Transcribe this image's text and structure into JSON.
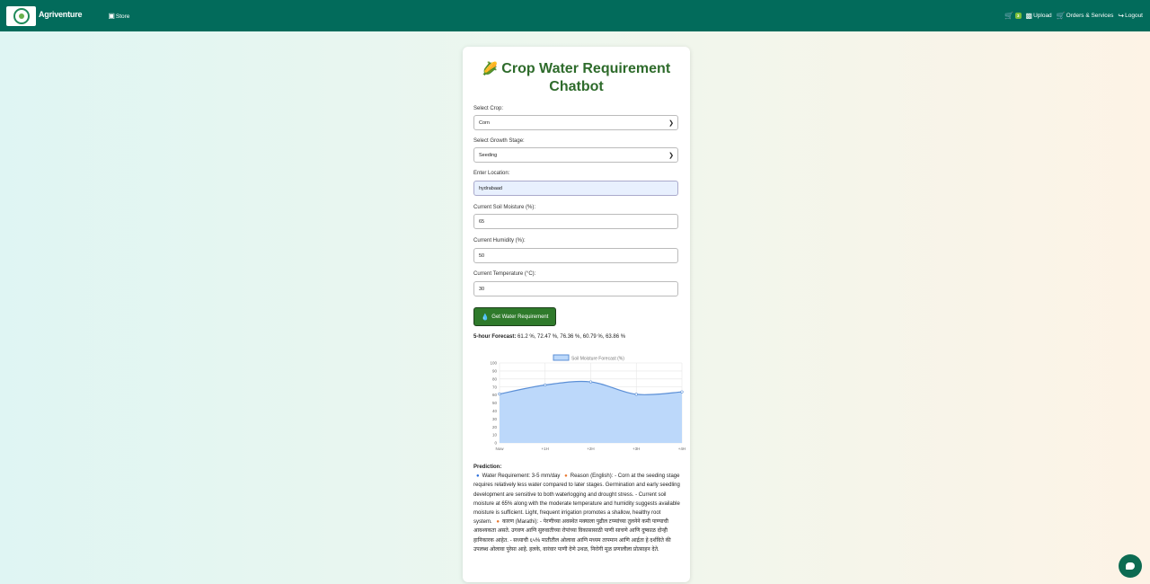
{
  "nav": {
    "brand": "Agriventure",
    "store": "Store",
    "cart_count": "3",
    "upload": "Upload",
    "orders": "Orders & Services",
    "logout": "Logout"
  },
  "card": {
    "title": "Crop Water Requirement Chatbot",
    "crop_label": "Select Crop:",
    "crop_value": "Corn",
    "stage_label": "Select Growth Stage:",
    "stage_value": "Seeding",
    "location_label": "Enter Location:",
    "location_value": "hydrabaad",
    "moisture_label": "Current Soil Moisture (%):",
    "moisture_value": "65",
    "humidity_label": "Current Humidity (%):",
    "humidity_value": "50",
    "temperature_label": "Current Temperature (°C):",
    "temperature_value": "30",
    "button_label": "Get Water Requirement",
    "forecast_label": "5-hour Forecast:",
    "forecast_values": "61.2 %, 72.47 %, 76.36 %, 60.79 %, 63.86 %"
  },
  "prediction": {
    "heading": "Prediction:",
    "water_req": "Water Requirement: 3-5 mm/day",
    "reason_en": "Reason (English): - Corn at the seeding stage requires relatively less water compared to later stages. Germination and early seedling development are sensitive to both waterlogging and drought stress. - Current soil moisture at 65% along with the moderate temperature and humidity suggests available moisture is sufficient. Light, frequent irrigation promotes a shallow, healthy root system.",
    "reason_mr": "कारण (Marathi): - पेरणीच्या अवस्थेत मक्याला पुढील टप्प्यांच्या तुलनेने कमी पाण्याची आवश्यकता असते. उगवण आणि सुरुवातीच्या रोपांच्या विकासासाठी पाणी साचणे आणि दुष्काळ दोन्ही हानिकारक आहेत. - सध्याची ६५% मातीतील ओलावा आणि मध्यम तापमान आणि आर्द्रता हे दर्शविते की उपलब्ध ओलावा पुरेसा आहे. हलके, वारंवार पाणी देणे उथळ, निरोगी मूळ प्रणालीला प्रोत्साहन देते."
  },
  "chart_data": {
    "type": "area",
    "legend": "Soil Moisture Forecast (%)",
    "categories": [
      "Now",
      "+1H",
      "+2H",
      "+3H",
      "+4H"
    ],
    "values": [
      61.2,
      72.47,
      76.36,
      60.79,
      63.86
    ],
    "ylim": [
      0,
      100
    ],
    "yticks": [
      "0",
      "10",
      "20",
      "30",
      "40",
      "50",
      "60",
      "70",
      "80",
      "90",
      "100"
    ],
    "fill_color": "#bcd8fa",
    "line_color": "#5b8fd6",
    "grid": true,
    "legend_position": "top"
  }
}
